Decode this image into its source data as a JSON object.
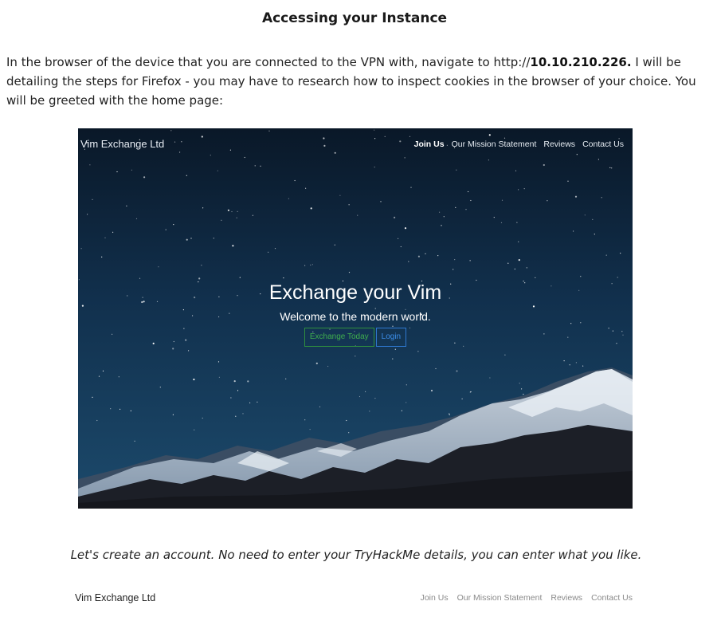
{
  "heading": "Accessing your Instance",
  "intro": {
    "text_before": "In the browser of the device that you are connected to the VPN with, navigate to http://",
    "ip": "10.10.210.226.",
    "text_after": " I will be detailing the steps for Firefox - you may have to research how to inspect cookies in the browser of your choice. You will be greeted with the home page:"
  },
  "site": {
    "brand": "Vim Exchange Ltd",
    "nav": [
      "Join Us",
      "Our Mission Statement",
      "Reviews",
      "Contact Us"
    ],
    "hero_title": "Exchange your Vim",
    "hero_subtitle": "Welcome to the modern world.",
    "buttons": {
      "exchange": "Exchange Today",
      "login": "Login"
    }
  },
  "caption": "Let's create an account. No need to enter your TryHackMe details, you can enter what you like.",
  "site2": {
    "brand": "Vim Exchange Ltd",
    "nav": [
      "Join Us",
      "Our Mission Statement",
      "Reviews",
      "Contact Us"
    ]
  },
  "colors": {
    "sky_top": "#0b1a2c",
    "sky_bottom": "#1d4b6e",
    "button_green": "#3fae4e",
    "button_blue": "#3b8de8"
  }
}
